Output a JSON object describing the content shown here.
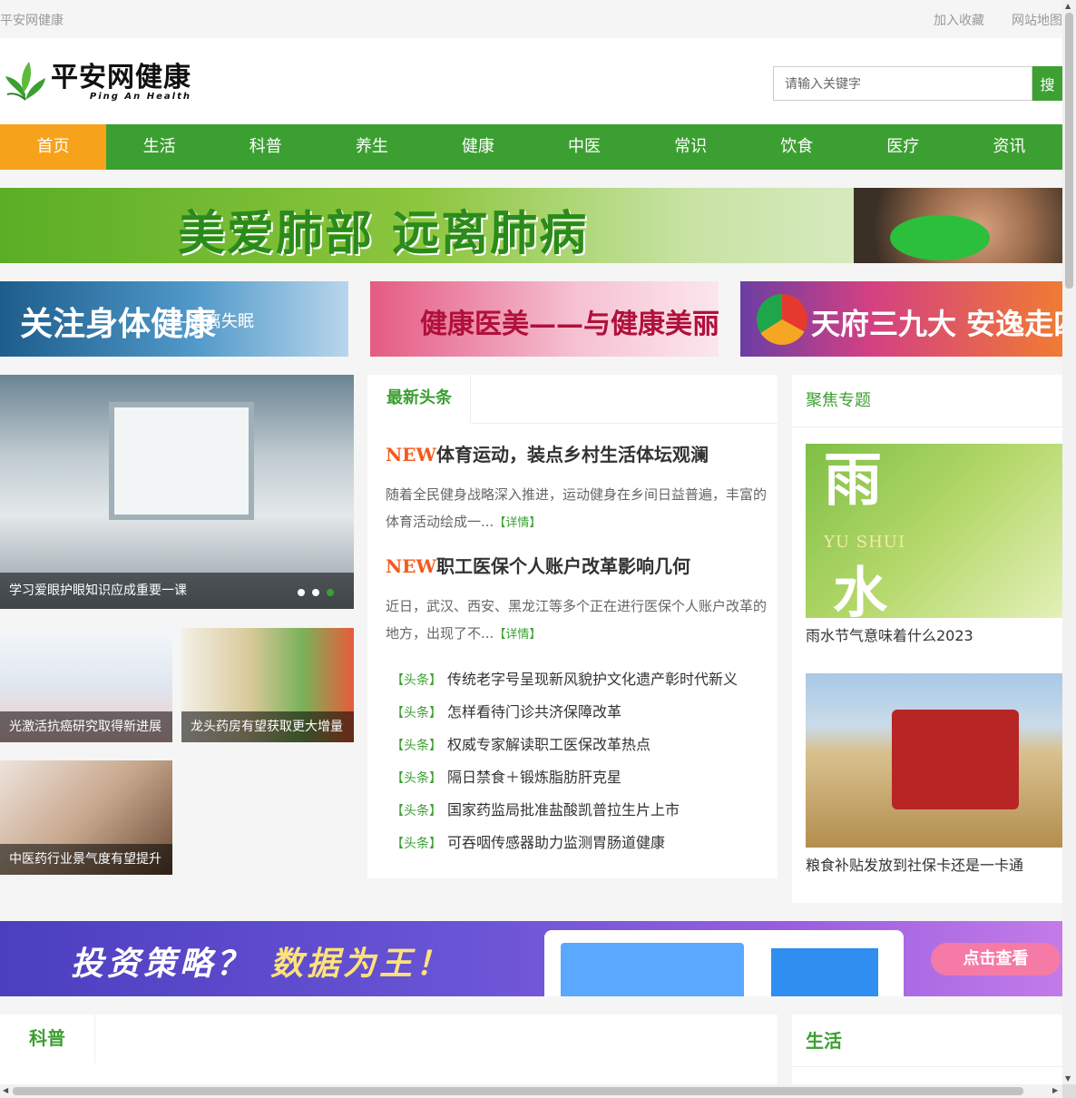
{
  "topbar": {
    "site_name": "平安网健康",
    "favorite": "加入收藏",
    "sitemap": "网站地图"
  },
  "logo": {
    "cn": "平安网健康",
    "en": "Ping An Health"
  },
  "search": {
    "placeholder": "请输入关键字",
    "button": "搜"
  },
  "nav": {
    "items": [
      "首页",
      "生活",
      "科普",
      "养生",
      "健康",
      "中医",
      "常识",
      "饮食",
      "医疗",
      "资讯"
    ],
    "active_color": "#f7a21b",
    "bar_color": "#3c9f32"
  },
  "banner_top": {
    "text": "美爱肺部 远离肺病"
  },
  "ads": [
    {
      "title": "关注身体健康",
      "sub": "—远离失眠"
    },
    {
      "title": "健康医美——与健康美丽同行"
    },
    {
      "title": "天府三九大 安逸走四川"
    }
  ],
  "slider": {
    "caption": "学习爱眼护眼知识应成重要一课",
    "dots": 3,
    "active_dot": 3
  },
  "thumbs": [
    {
      "caption": "光激活抗癌研究取得新进展"
    },
    {
      "caption": "龙头药房有望获取更大增量"
    },
    {
      "caption": "中医药行业景气度有望提升"
    }
  ],
  "headlines": {
    "tab": "最新头条",
    "articles": [
      {
        "new_tag": "NEW",
        "title": "体育运动，装点乡村生活体坛观澜",
        "desc": "随着全民健身战略深入推进，运动健身在乡间日益普遍，丰富的体育活动绘成一...",
        "more": "【详情】"
      },
      {
        "new_tag": "NEW",
        "title": "职工医保个人账户改革影响几何",
        "desc": "近日，武汉、西安、黑龙江等多个正在进行医保个人账户改革的地方，出现了不...",
        "more": "【详情】"
      }
    ],
    "tag": "【头条】",
    "list": [
      "传统老字号呈现新风貌护文化遗产彰时代新义",
      "怎样看待门诊共济保障改革",
      "权威专家解读职工医保改革热点",
      "隔日禁食＋锻炼脂肪肝克星",
      "国家药监局批准盐酸凯普拉生片上市",
      "可吞咽传感器助力监测胃肠道健康"
    ]
  },
  "focus": {
    "title": "聚焦专题",
    "items": [
      {
        "caption": "雨水节气意味着什么2023",
        "img_text_1": "雨",
        "img_text_en": "YU SHUI",
        "img_text_2": "水"
      },
      {
        "caption": "粮食补贴发放到社保卡还是一卡通"
      }
    ]
  },
  "banner_mid": {
    "text1": "投资策略？",
    "text2": "数据为王！",
    "button": "点击查看"
  },
  "sections": {
    "left": "科普",
    "right": "生活"
  }
}
